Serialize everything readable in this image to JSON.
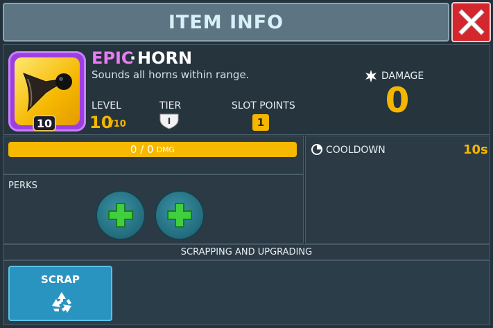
{
  "header": {
    "title": "ITEM INFO"
  },
  "item": {
    "rarity": "EPIC",
    "separator": "·",
    "name": "HORN",
    "description": "Sounds all horns within range.",
    "level_badge": "10",
    "icon": "horn-icon"
  },
  "stats": {
    "level_label": "LEVEL",
    "level_value": "10",
    "level_max": "/10",
    "tier_label": "TIER",
    "tier_value": "I",
    "slot_label": "SLOT POINTS",
    "slot_value": "1",
    "damage_label": "DAMAGE",
    "damage_value": "0"
  },
  "progress": {
    "text": "0 / 0",
    "unit": "DMG",
    "fill_fraction": 1.0
  },
  "perks": {
    "label": "PERKS",
    "slots": [
      "add-perk",
      "add-perk"
    ]
  },
  "cooldown": {
    "label": "COOLDOWN",
    "value": "10s"
  },
  "scrapping": {
    "header": "SCRAPPING AND UPGRADING",
    "scrap_label": "SCRAP"
  },
  "colors": {
    "accent": "#f5b600",
    "rarity_epic": "#e97cf3",
    "close": "#d3272d",
    "scrap": "#2a94c0"
  }
}
